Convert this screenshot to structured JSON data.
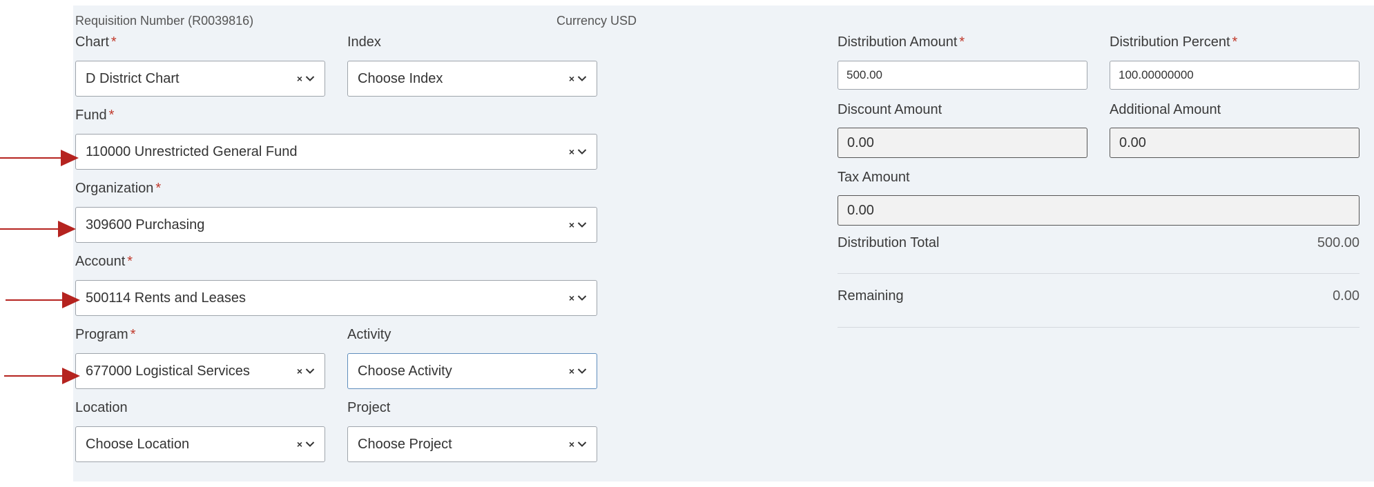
{
  "header": {
    "requisition_number": "Requisition Number (R0039816)",
    "currency": "Currency USD"
  },
  "accounting": {
    "chart": {
      "label": "Chart",
      "value": "D District Chart",
      "required": true
    },
    "index": {
      "label": "Index",
      "value": "Choose Index",
      "required": false
    },
    "fund": {
      "label": "Fund",
      "value": "110000 Unrestricted General Fund",
      "required": true
    },
    "organization": {
      "label": "Organization",
      "value": "309600 Purchasing",
      "required": true
    },
    "account": {
      "label": "Account",
      "value": "500114 Rents and Leases",
      "required": true
    },
    "program": {
      "label": "Program",
      "value": "677000 Logistical Services",
      "required": true
    },
    "activity": {
      "label": "Activity",
      "value": "Choose Activity",
      "required": false
    },
    "location": {
      "label": "Location",
      "value": "Choose Location",
      "required": false
    },
    "project": {
      "label": "Project",
      "value": "Choose Project",
      "required": false
    }
  },
  "distribution": {
    "amount": {
      "label": "Distribution Amount",
      "value": "500.00",
      "required": true
    },
    "percent": {
      "label": "Distribution Percent",
      "value": "100.00000000",
      "required": true
    },
    "discount": {
      "label": "Discount Amount",
      "value": "0.00"
    },
    "additional": {
      "label": "Additional Amount",
      "value": "0.00"
    },
    "tax": {
      "label": "Tax Amount",
      "value": "0.00"
    },
    "total": {
      "label": "Distribution Total",
      "value": "500.00"
    },
    "remaining": {
      "label": "Remaining",
      "value": "0.00"
    }
  },
  "icons": {
    "clear": "×",
    "required_marker": "*",
    "chevron": "chevron-down-icon",
    "annotation_arrow": "arrow-right-icon"
  },
  "colors": {
    "required": "#c0392b",
    "annotation_arrow": "#b5231f",
    "panel_background": "#eff3f7",
    "focus_border": "#5f8dbd"
  }
}
